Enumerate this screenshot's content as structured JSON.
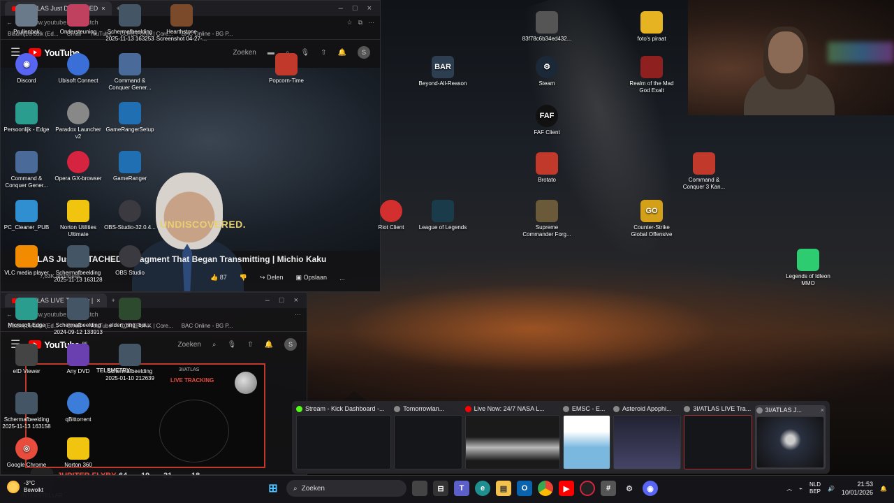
{
  "browser1": {
    "tab_title": "3I/ATLAS Just DETACHED",
    "url": "www.youtube.com/watch",
    "bookmarks": [
      "Bladwijzerbalk (Ed...",
      "Gmail",
      "YouTube",
      "COREPUNK | Core...",
      "BAC Online - BG P..."
    ],
    "yt_logo": "YouTube",
    "yt_search": "Zoeken",
    "avatar_letter": "S",
    "video_subtitle": "UNDISCOVERED.",
    "video_title": "3I/ATLAS Just DETACHED a Fragment That Began Transmitting | Michio Kaku",
    "channel_subs": "7,63K abonnees",
    "likes": "87",
    "share": "Delen",
    "save": "Opslaan",
    "more": "..."
  },
  "browser2": {
    "tab_title": "3I/ATLAS LIVE Tracking |",
    "url": "www.youtube.com/watch",
    "bookmarks": [
      "Bladwijzerbalk (Ed...",
      "Gmail",
      "YouTube",
      "COREPUNK | Core...",
      "BAC Online - BG P..."
    ],
    "yt_logo": "YouTube",
    "yt_country": "BE",
    "yt_search": "Zoeken",
    "avatar_letter": "S",
    "panel_title": "3I/ATLAS",
    "panel_live": "LIVE TRACKING",
    "telemetry": "TELEMETRY",
    "flyby_label": "JUPITER FLYBY",
    "flyby_values": [
      "64",
      "19",
      "21",
      "18"
    ]
  },
  "desktop_icons": [
    {
      "id": "prullenbak",
      "label": "Prullenbak",
      "color": "#6b7a8a"
    },
    {
      "id": "ondersteuning",
      "label": "Ondersteuning",
      "color": "#c04060"
    },
    {
      "id": "schermafbeelding1",
      "label": "Schermafbeelding 2025-11-13 163253",
      "color": "#445566"
    },
    {
      "id": "hearthstone",
      "label": "Hearthstone Screenshot 04-27-...",
      "color": "#7a4a2a"
    },
    {
      "id": "discord",
      "label": "Discord",
      "color": "#5865f2"
    },
    {
      "id": "ubisoft",
      "label": "Ubisoft Connect",
      "color": "#3a6fd8"
    },
    {
      "id": "cnc-generals",
      "label": "Command & Conquer Gener...",
      "color": "#4a6b9a"
    },
    {
      "id": "popcorn",
      "label": "Popcorn-Time",
      "color": "#c0392b"
    },
    {
      "id": "edge-personal",
      "label": "Persoonlijk - Edge",
      "color": "#2a9d8f"
    },
    {
      "id": "paradox",
      "label": "Paradox Launcher v2",
      "color": "#888888"
    },
    {
      "id": "gameranger-setup",
      "label": "GameRangerSetup",
      "color": "#1f6fb2"
    },
    {
      "id": "cnc-generals2",
      "label": "Command & Conquer Gener...",
      "color": "#4a6b9a"
    },
    {
      "id": "opera-gx",
      "label": "Opera GX-browser",
      "color": "#d6233f"
    },
    {
      "id": "gameranger",
      "label": "GameRanger",
      "color": "#1f6fb2"
    },
    {
      "id": "pc-cleaner",
      "label": "PC_Cleaner_PUB",
      "color": "#2f8fd0"
    },
    {
      "id": "norton-utilities",
      "label": "Norton Utilities Ultimate",
      "color": "#f1c40f"
    },
    {
      "id": "obs32",
      "label": "OBS-Studio-32.0.4...",
      "color": "#3a3a40"
    },
    {
      "id": "vlc",
      "label": "VLC media player",
      "color": "#f28b00"
    },
    {
      "id": "schermafbeelding2",
      "label": "Schermafbeelding 2025-11-13 163128",
      "color": "#445566"
    },
    {
      "id": "obs",
      "label": "OBS Studio",
      "color": "#3a3a40"
    },
    {
      "id": "edge",
      "label": "Microsoft Edge",
      "color": "#2a9d8f"
    },
    {
      "id": "schermafbeelding3",
      "label": "Schermafbeelding 2024-09-12 133913",
      "color": "#445566"
    },
    {
      "id": "elden-ring",
      "label": "elden_ring_bui...",
      "color": "#2e4a2e"
    },
    {
      "id": "eid",
      "label": "eID Viewer",
      "color": "#444444"
    },
    {
      "id": "any-dvd",
      "label": "Any DVD",
      "color": "#6a3fb0"
    },
    {
      "id": "schermafbeelding4",
      "label": "Schermafbeelding 2025-01-10 212639",
      "color": "#445566"
    },
    {
      "id": "schermafbeelding5",
      "label": "Schermafbeelding 2025-11-13 163158",
      "color": "#445566"
    },
    {
      "id": "qbittorrent",
      "label": "qBittorrent",
      "color": "#3b7dd8"
    },
    {
      "id": "chrome",
      "label": "Google Chrome",
      "color": "#e74c3c"
    },
    {
      "id": "norton360",
      "label": "Norton 360",
      "color": "#f1c40f"
    },
    {
      "id": "interstellar",
      "label": "INTERSTELLAR",
      "color": "#222222"
    },
    {
      "id": "hash",
      "label": "83f78c6b34ed432...",
      "color": "#555555"
    },
    {
      "id": "fotos-piraat",
      "label": "foto's piraat",
      "color": "#e6b422"
    },
    {
      "id": "bar",
      "label": "Beyond-All-Reason",
      "color": "#2c3e50"
    },
    {
      "id": "steam",
      "label": "Steam",
      "color": "#1b2838"
    },
    {
      "id": "realm",
      "label": "Realm of the Mad God Exalt",
      "color": "#8e2020"
    },
    {
      "id": "faf",
      "label": "FAF Client",
      "color": "#111111"
    },
    {
      "id": "brotato",
      "label": "Brotato",
      "color": "#c0392b"
    },
    {
      "id": "cnc3",
      "label": "Command & Conquer 3 Kan...",
      "color": "#c0392b"
    },
    {
      "id": "riot",
      "label": "Riot Client",
      "color": "#d32f2f"
    },
    {
      "id": "lol",
      "label": "League of Legends",
      "color": "#1a3c4a"
    },
    {
      "id": "supcom",
      "label": "Supreme Commander Forg...",
      "color": "#6a5a3a"
    },
    {
      "id": "csgo",
      "label": "Counter-Strike Global Offensive",
      "color": "#d4a017"
    },
    {
      "id": "legends-idleon",
      "label": "Legends of Idleon MMO",
      "color": "#2ecc71"
    }
  ],
  "icon_glyphs": {
    "bar": "BAR",
    "faf": "FAF",
    "csgo": "GO",
    "discord": "◉",
    "steam": "⚙",
    "chrome": "◎"
  },
  "thumbnails": [
    {
      "title": "Stream - Kick Dashboard -...",
      "fav": "#53fc18"
    },
    {
      "title": "Tomorrowlan...",
      "fav": "#888888"
    },
    {
      "title": "Live Now: 24/7 NASA L...",
      "fav": "#ff0000"
    },
    {
      "title": "EMSC - E...",
      "fav": "#888888"
    },
    {
      "title": "Asteroid Apophi...",
      "fav": "#888888"
    },
    {
      "title": "3I/ATLAS LIVE Tra...",
      "fav": "#888888"
    },
    {
      "title": "3I/ATLAS J...",
      "fav": "#888888"
    }
  ],
  "taskbar": {
    "weather_temp": "-3°C",
    "weather_desc": "Bewolkt",
    "search_placeholder": "Zoeken",
    "lang_top": "NLD",
    "lang_bottom": "BEP",
    "time": "21:53",
    "date": "10/01/2026"
  }
}
